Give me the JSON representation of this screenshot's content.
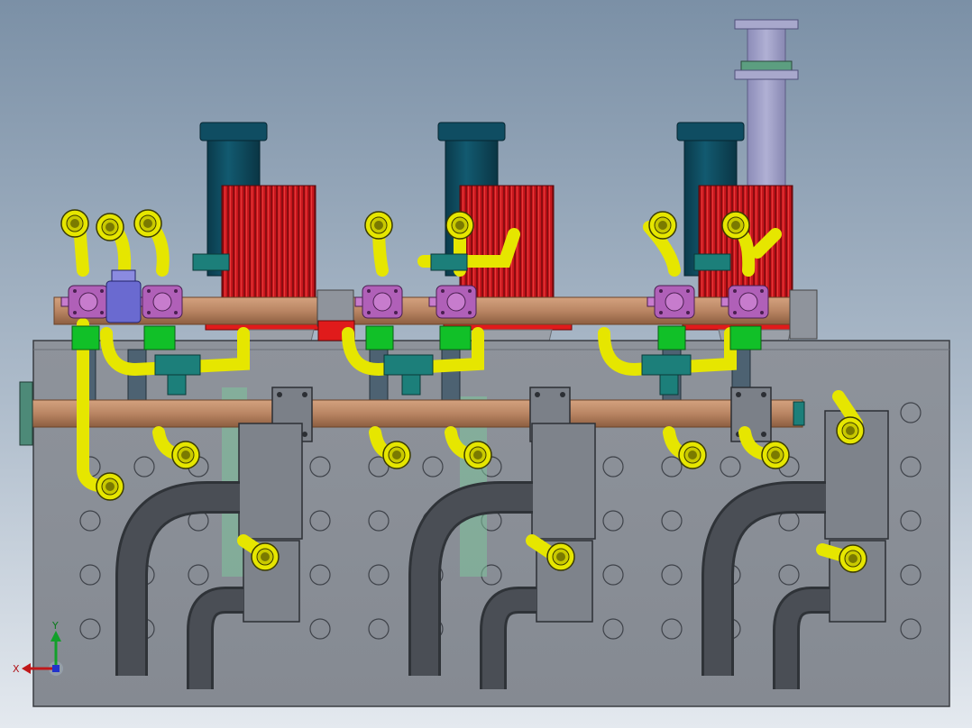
{
  "scene": {
    "subject": "cad-assembly-front-view",
    "colors": {
      "background_top": "#7d92a8",
      "background_bottom": "#dfe5ec",
      "tank": "#8b9098",
      "tank_dark": "#6f747b",
      "perforation": "#7f848c",
      "motor": "#0f4a5e",
      "pump_head": "#c8161d",
      "flange": "#e01b1b",
      "fitting": "#e6e600",
      "valve": "#b060b8",
      "green_band": "#11c028",
      "teal_fitting": "#1c7f7a",
      "copper_pipe": "#b98563",
      "dark_pipe": "#3e4248",
      "exhaust": "#9f9fc6",
      "bracket": "#7b8088"
    }
  },
  "triad": {
    "x_label": "X",
    "y_label": "Y",
    "x_color": "#c0181a",
    "y_color": "#12a02a"
  }
}
